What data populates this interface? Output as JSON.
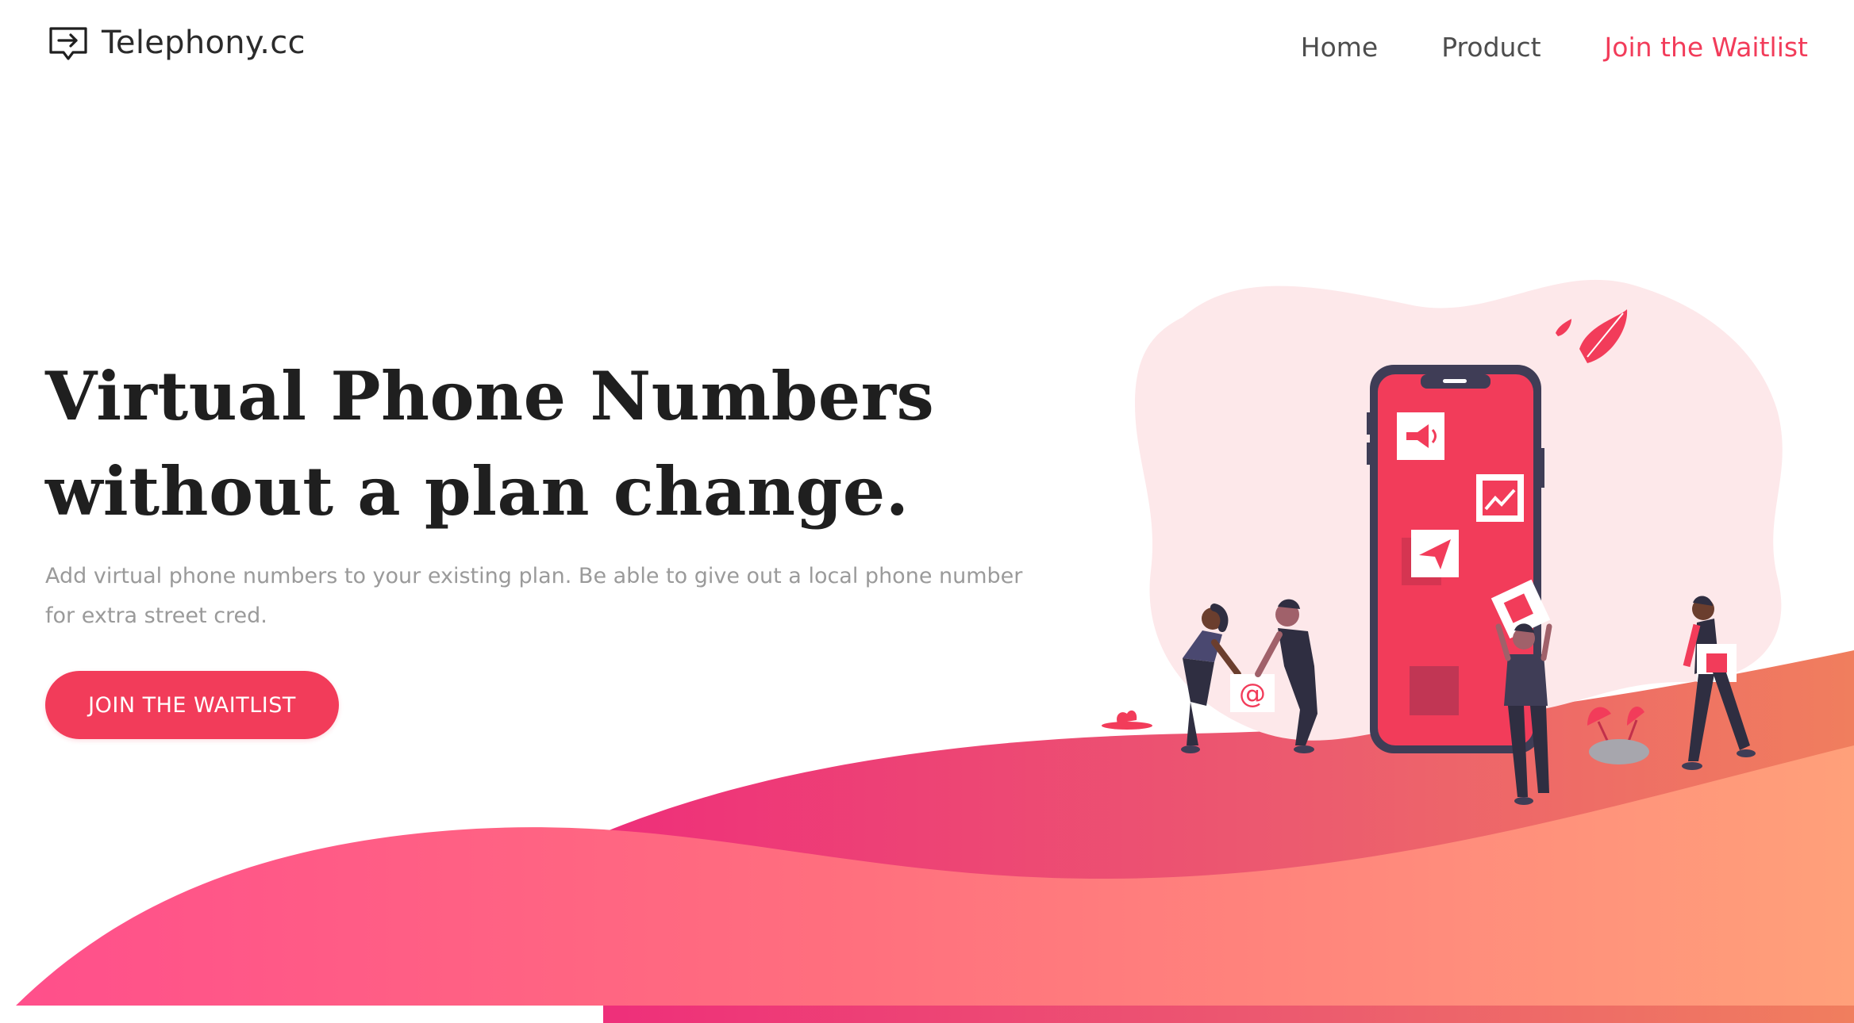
{
  "brand": {
    "name": "Telephony.cc",
    "icon": "message-arrow-icon"
  },
  "nav": {
    "items": [
      {
        "label": "Home"
      },
      {
        "label": "Product"
      },
      {
        "label": "Join the Waitlist"
      }
    ]
  },
  "hero": {
    "title_line1": "Virtual Phone Numbers",
    "title_line2": "without a plan change.",
    "subtitle": "Add virtual phone numbers to your existing plan. Be able to give out a local phone number for extra street cred.",
    "cta_label": "JOIN THE WAITLIST"
  },
  "colors": {
    "accent": "#f23c5a",
    "title": "#1f1f1f",
    "subtitle": "#9a9a9a",
    "nav_text": "#4d4d4d",
    "blob": "#fde8ea",
    "phone_frame": "#3f3d56",
    "wave_start": "#ff4f8b",
    "wave_end": "#ff9f7a"
  },
  "illustration": {
    "icons": [
      "megaphone-icon",
      "chart-icon",
      "paper-plane-icon",
      "at-sign-icon",
      "building-icon",
      "leaf-icon"
    ]
  }
}
